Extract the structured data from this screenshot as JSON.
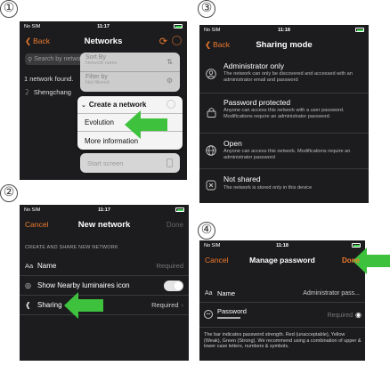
{
  "steps": [
    "①",
    "②",
    "③",
    "④"
  ],
  "status": {
    "carrier": "No SIM",
    "time1": "11:17",
    "time2": "11:17",
    "time3": "11:18",
    "time4": "11:18"
  },
  "colors": {
    "accent": "#f07a2e",
    "arrow": "#3ec23e",
    "bg": "#1c1c1e",
    "row": "#2c2c2e"
  },
  "screen1": {
    "back_label": "Back",
    "title": "Networks",
    "search_placeholder": "Search by network",
    "found_text": "1 network found.",
    "network_name": "Shengchang",
    "sort_menu": [
      {
        "label": "Sort By",
        "sub": "Network name"
      },
      {
        "label": "Filter by",
        "sub": "Not filtered"
      }
    ],
    "create_menu": {
      "header": "Create a network",
      "items": [
        "Evolution",
        "More information"
      ]
    },
    "start_screen": "Start screen"
  },
  "screen2": {
    "cancel": "Cancel",
    "title": "New network",
    "done": "Done",
    "section_header": "CREATE AND SHARE NEW NETWORK",
    "name_prefix": "Aa",
    "name_label": "Name",
    "name_placeholder": "Required",
    "show_icon_label": "Show Nearby luminaires icon",
    "sharing_label": "Sharing",
    "sharing_value": "Required"
  },
  "screen3": {
    "back_label": "Back",
    "title": "Sharing mode",
    "options": [
      {
        "title": "Administrator only",
        "desc": "The network can only be discovered and accessed with an administrator email and password",
        "icon": "admin-icon"
      },
      {
        "title": "Password protected",
        "desc": "Anyone can access this network with a user password. Modifications require an administrator password.",
        "icon": "lock-icon"
      },
      {
        "title": "Open",
        "desc": "Anyone can access this network. Modifications require an administrator password",
        "icon": "globe-icon"
      },
      {
        "title": "Not shared",
        "desc": "The network is stored only in this device",
        "icon": "not-shared-icon"
      }
    ]
  },
  "screen4": {
    "cancel": "Cancel",
    "title": "Manage password",
    "done": "Done",
    "name_prefix": "Aa",
    "name_label": "Name",
    "name_value": "Administrator pass...",
    "password_label": "Password",
    "password_placeholder": "Required",
    "hint": "The bar indicates password strength. Red (unacceptable), Yellow (Weak), Green (Strong). We recommend using a combination of upper & lower case letters, numbers & symbols."
  }
}
